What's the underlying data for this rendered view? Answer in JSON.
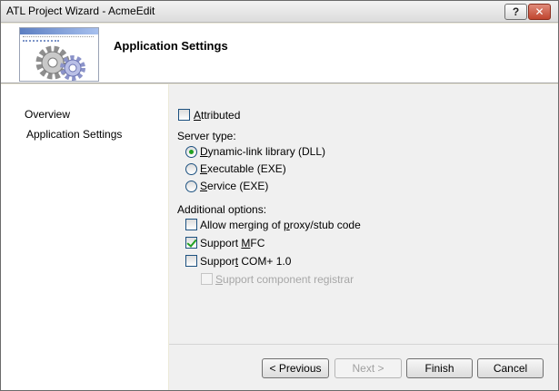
{
  "window": {
    "title": "ATL Project Wizard - AcmeEdit",
    "help_glyph": "?",
    "close_glyph": "✕"
  },
  "header": {
    "title": "Application Settings"
  },
  "nav": {
    "items": [
      {
        "label": "Overview"
      },
      {
        "label": "Application Settings"
      }
    ]
  },
  "options": {
    "attributed": {
      "pre": "",
      "key": "A",
      "post": "ttributed",
      "checked": false
    },
    "server_type_label": "Server type:",
    "server_types": [
      {
        "pre": "",
        "key": "D",
        "post": "ynamic-link library (DLL)",
        "selected": true
      },
      {
        "pre": "",
        "key": "E",
        "post": "xecutable (EXE)",
        "selected": false
      },
      {
        "pre": "",
        "key": "S",
        "post": "ervice (EXE)",
        "selected": false
      }
    ],
    "additional_label": "Additional options:",
    "additional": [
      {
        "pre": "Allow merging of ",
        "key": "p",
        "post": "roxy/stub code",
        "checked": false,
        "enabled": true
      },
      {
        "pre": "Support ",
        "key": "M",
        "post": "FC",
        "checked": true,
        "enabled": true
      },
      {
        "pre": "Suppor",
        "key": "t",
        "post": " COM+ 1.0",
        "checked": false,
        "enabled": true
      },
      {
        "pre": "",
        "key": "S",
        "post": "upport component registrar",
        "checked": false,
        "enabled": false
      }
    ]
  },
  "buttons": {
    "previous": "< Previous",
    "next": "Next >",
    "finish": "Finish",
    "cancel": "Cancel"
  },
  "colors": {
    "accent_check": "#21a121",
    "header_bg": "#ffffff",
    "panel_bg": "#f0f0f0"
  }
}
